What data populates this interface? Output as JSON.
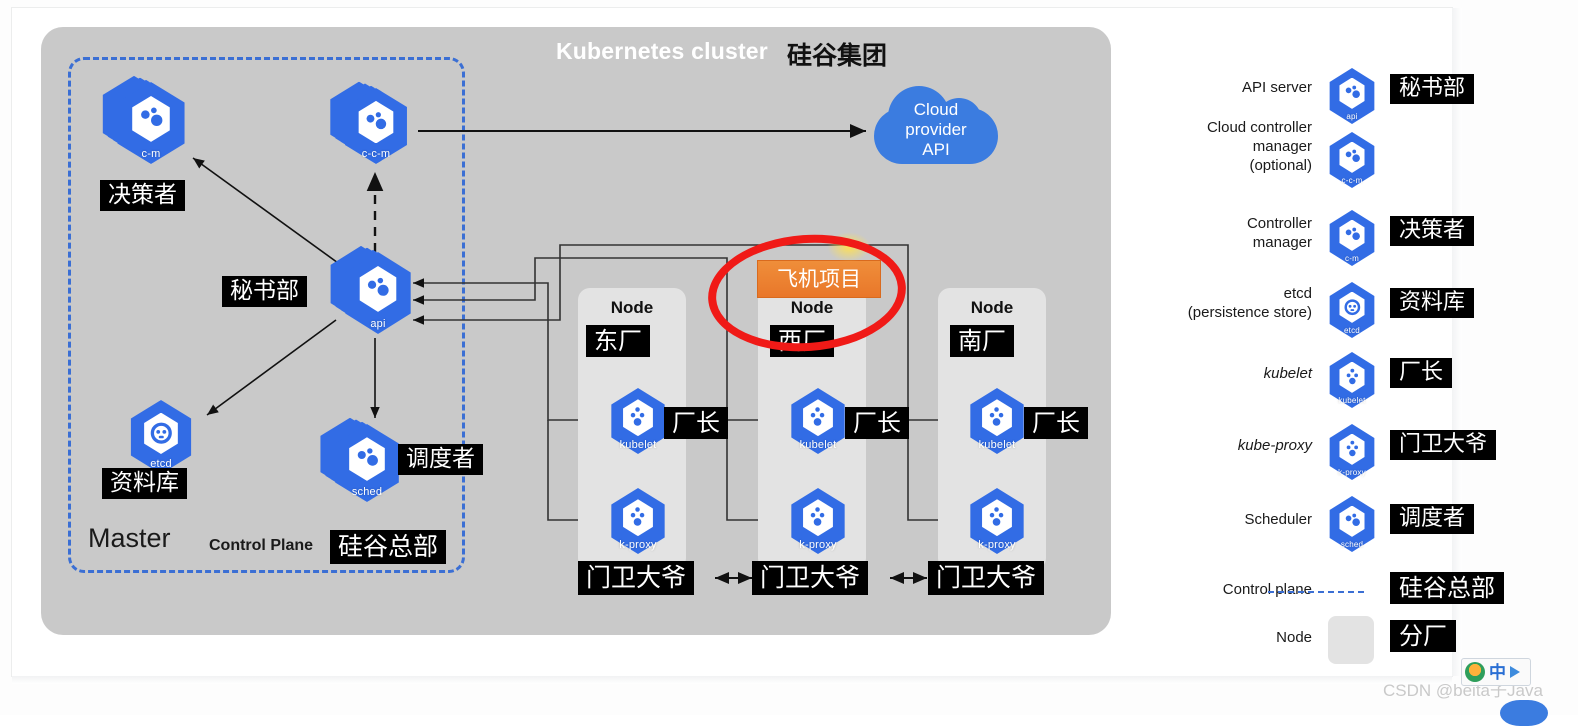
{
  "slide": {
    "cluster_title_en": "Kubernetes cluster",
    "cluster_title_cn": "硅谷集团",
    "master_label": "Master",
    "control_plane_label": "Control Plane",
    "control_plane_cn": "硅谷总部",
    "cloud": {
      "line1": "Cloud",
      "line2": "provider",
      "line3": "API"
    }
  },
  "control_plane_components": [
    {
      "id": "c-m",
      "caption": "c-m",
      "cn": "决策者"
    },
    {
      "id": "c-c-m",
      "caption": "c-c-m",
      "cn": ""
    },
    {
      "id": "api",
      "caption": "api",
      "cn": "秘书部"
    },
    {
      "id": "etcd",
      "caption": "etcd",
      "cn": "资料库"
    },
    {
      "id": "sched",
      "caption": "sched",
      "cn": "调度者"
    }
  ],
  "nodes": [
    {
      "title": "Node",
      "cn": "东厂",
      "kubelet_caption": "kubelet",
      "kubelet_cn": "厂长",
      "kproxy_caption": "k-proxy",
      "kproxy_cn": "门卫大爷"
    },
    {
      "title": "Node",
      "cn": "西厂",
      "kubelet_caption": "kubelet",
      "kubelet_cn": "厂长",
      "kproxy_caption": "k-proxy",
      "kproxy_cn": "门卫大爷"
    },
    {
      "title": "Node",
      "cn": "南厂",
      "kubelet_caption": "kubelet",
      "kubelet_cn": "厂长",
      "kproxy_caption": "k-proxy",
      "kproxy_cn": "门卫大爷"
    }
  ],
  "annotation": {
    "orange_box_text": "飞机项目",
    "orange_color": "#e9772a",
    "circle_color": "#f01a17"
  },
  "legend": [
    {
      "text": "API server",
      "icon": "api",
      "caption": "api",
      "cn": "秘书部"
    },
    {
      "text": "Cloud controller\nmanager\n(optional)",
      "icon": "c-c-m",
      "caption": "c-c-m",
      "cn": ""
    },
    {
      "text": "Controller\nmanager",
      "icon": "c-m",
      "caption": "c-m",
      "cn": "决策者"
    },
    {
      "text": "etcd\n(persistence store)",
      "icon": "etcd",
      "caption": "etcd",
      "cn": "资料库"
    },
    {
      "text": "kubelet",
      "icon": "kubelet",
      "caption": "kubelet",
      "cn": "厂长"
    },
    {
      "text": "kube-proxy",
      "icon": "k-proxy",
      "caption": "k-proxy",
      "cn": "门卫大爷"
    },
    {
      "text": "Scheduler",
      "icon": "sched",
      "caption": "sched",
      "cn": "调度者"
    },
    {
      "text": "Control plane",
      "icon": "dash",
      "caption": "",
      "cn": "硅谷总部"
    },
    {
      "text": "Node",
      "icon": "swatch",
      "caption": "",
      "cn": "分厂"
    }
  ],
  "watermark": {
    "text": "CSDN @beita子Java",
    "ime_label": "中"
  },
  "colors": {
    "k8s_blue": "#326ce5",
    "cluster_bg": "#c9c9c9",
    "node_bg": "#e3e3e3",
    "control_plane_dash": "#3b6fd4"
  }
}
